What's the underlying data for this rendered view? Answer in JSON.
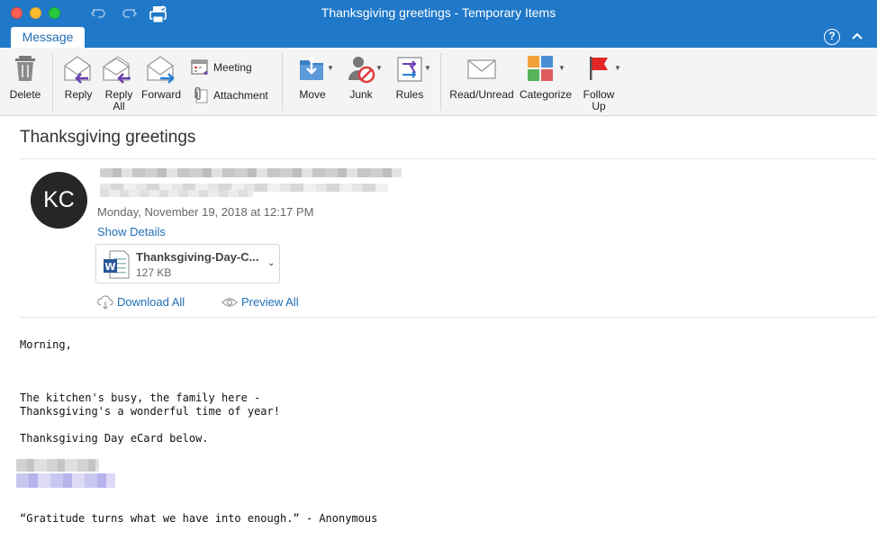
{
  "window": {
    "title": "Thanksgiving greetings - Temporary Items"
  },
  "tabs": {
    "message": "Message"
  },
  "ribbon": {
    "delete": "Delete",
    "reply": "Reply",
    "reply_all_1": "Reply",
    "reply_all_2": "All",
    "forward": "Forward",
    "meeting": "Meeting",
    "attachment": "Attachment",
    "move": "Move",
    "junk": "Junk",
    "rules": "Rules",
    "read_unread": "Read/Unread",
    "categorize": "Categorize",
    "follow_up_1": "Follow",
    "follow_up_2": "Up"
  },
  "email": {
    "subject": "Thanksgiving greetings",
    "avatar_initials": "KC",
    "datetime": "Monday, November 19, 2018 at 12:17 PM",
    "show_details": "Show Details",
    "attachment": {
      "name": "Thanksgiving-Day-C...",
      "size": "127 KB"
    },
    "download_all": "Download All",
    "preview_all": "Preview All",
    "body": {
      "line1": "Morning,",
      "line2": "The kitchen's busy, the family here -",
      "line3": "Thanksgiving's a wonderful time of year!",
      "line4": "Thanksgiving Day eCard below.",
      "line5": "“Gratitude turns what we have into enough.” - Anonymous"
    }
  },
  "colors": {
    "accent": "#1f78c8",
    "link": "#1f6fb5",
    "avatar_bg": "#262626"
  },
  "icons": [
    "undo-icon",
    "redo-icon",
    "print-icon",
    "help-icon",
    "collapse-icon",
    "trash-icon",
    "reply-icon",
    "reply-all-icon",
    "forward-icon",
    "meeting-icon",
    "paperclip-icon",
    "move-icon",
    "junk-icon",
    "rules-icon",
    "envelope-icon",
    "categorize-icon",
    "flag-icon",
    "word-doc-icon",
    "cloud-download-icon",
    "eye-icon"
  ]
}
